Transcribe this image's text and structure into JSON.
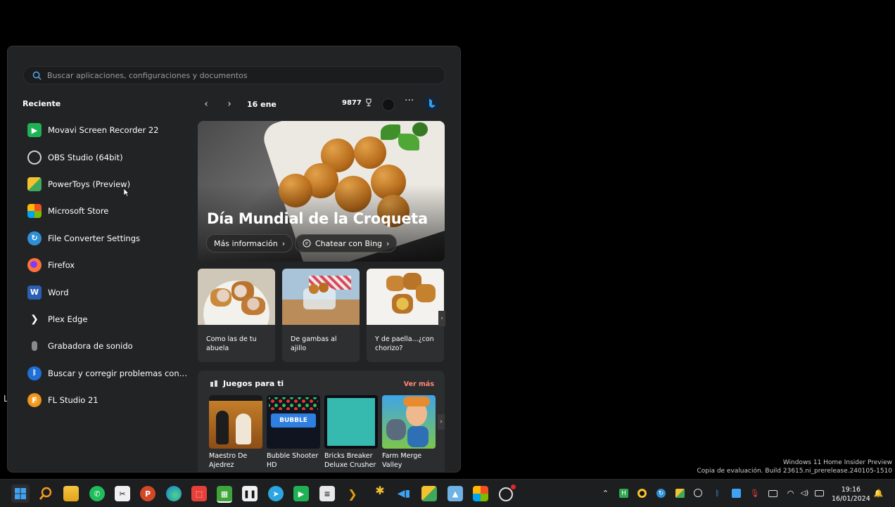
{
  "start": {
    "search_placeholder": "Buscar aplicaciones, configuraciones y documentos",
    "recent_title": "Reciente",
    "recent": [
      {
        "label": "Movavi Screen Recorder 22",
        "icon": "movavi-icon",
        "color": "#1fb254"
      },
      {
        "label": "OBS Studio (64bit)",
        "icon": "obs-icon",
        "color": "#3a3a3a"
      },
      {
        "label": "PowerToys (Preview)",
        "icon": "powertoys-icon",
        "color": "#e0a12a"
      },
      {
        "label": "Microsoft Store",
        "icon": "store-icon",
        "color": "#2b88d8"
      },
      {
        "label": "File Converter Settings",
        "icon": "file-converter-icon",
        "color": "#2f8fd6"
      },
      {
        "label": "Firefox",
        "icon": "firefox-icon",
        "color": "#ff7139"
      },
      {
        "label": "Word",
        "icon": "word-icon",
        "color": "#2b5fb4"
      },
      {
        "label": "Plex Edge",
        "icon": "plex-icon",
        "color": "#222325"
      },
      {
        "label": "Grabadora de sonido",
        "icon": "microphone-icon",
        "color": "#7d7d7d"
      },
      {
        "label": "Buscar y corregir problemas con disp...",
        "icon": "bluetooth-icon",
        "color": "#1f6fd6"
      },
      {
        "label": "FL Studio 21",
        "icon": "fl-studio-icon",
        "color": "#f29a1e"
      }
    ]
  },
  "widget": {
    "date": "16 ene",
    "points": "9877",
    "hero_title": "Día Mundial de la Croqueta",
    "hero_more": "Más información",
    "hero_chat": "Chatear con Bing",
    "cards": [
      {
        "caption": "Como las de tu abuela"
      },
      {
        "caption": "De gambas al ajillo"
      },
      {
        "caption": "Y de paella...¿con chorizo?"
      }
    ],
    "games_title": "Juegos para ti",
    "games_more": "Ver más",
    "games": [
      {
        "name": "Maestro De Ajedrez"
      },
      {
        "name": "Bubble Shooter HD"
      },
      {
        "name": "Bricks Breaker Deluxe Crusher"
      },
      {
        "name": "Farm Merge Valley"
      }
    ]
  },
  "desktop": {
    "stray_letter": "L",
    "watermark_line1": "Windows 11 Home Insider Preview",
    "watermark_line2": "Copia de evaluación. Build 23615.ni_prerelease.240105-1510"
  },
  "taskbar": {
    "time": "19:16",
    "date": "16/01/2024"
  },
  "colors": {
    "start_bg": "#222325",
    "accent_link": "#ff8a74",
    "taskbar_bg": "#1d1e20"
  }
}
